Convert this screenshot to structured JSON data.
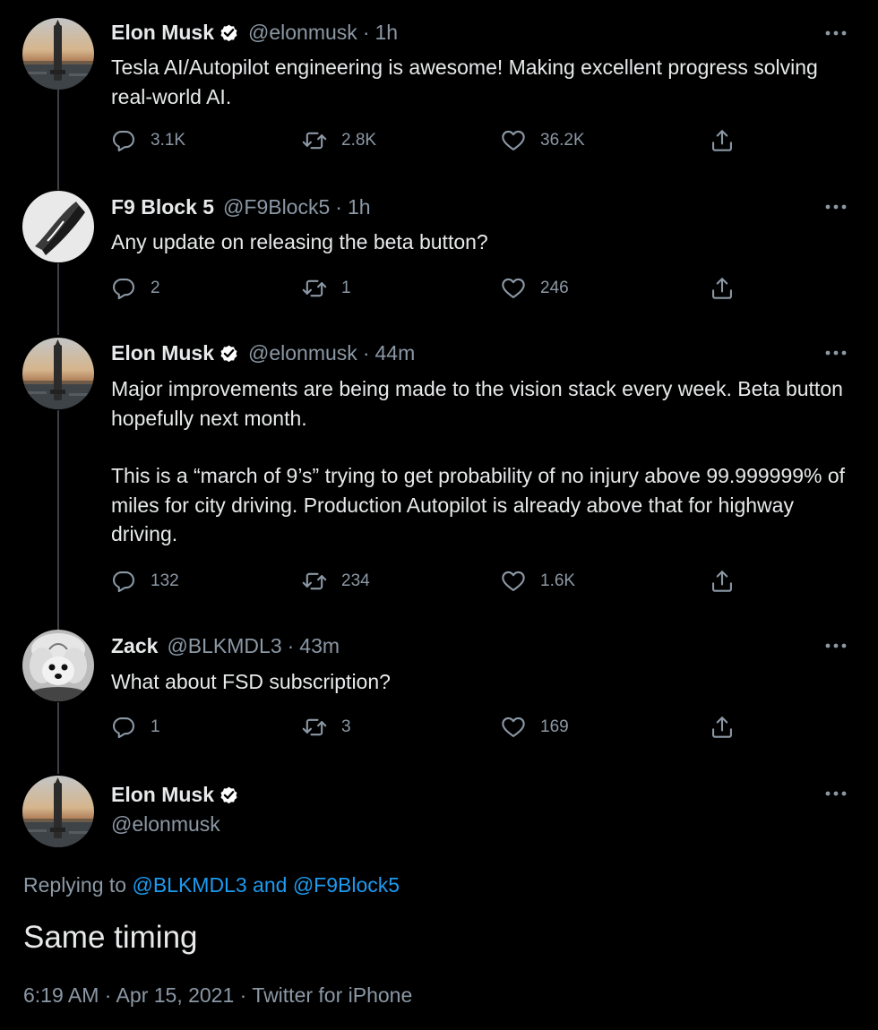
{
  "thread": [
    {
      "name": "Elon Musk",
      "verified": true,
      "handle": "@elonmusk",
      "separator": "·",
      "time": "1h",
      "paragraphs": [
        "Tesla AI/Autopilot engineering is awesome! Making excellent progress solving real-world AI."
      ],
      "replies": "3.1K",
      "retweets": "2.8K",
      "likes": "36.2K"
    },
    {
      "name": "F9 Block 5",
      "verified": false,
      "handle": "@F9Block5",
      "separator": "·",
      "time": "1h",
      "paragraphs": [
        "Any update on releasing the beta button?"
      ],
      "replies": "2",
      "retweets": "1",
      "likes": "246"
    },
    {
      "name": "Elon Musk",
      "verified": true,
      "handle": "@elonmusk",
      "separator": "·",
      "time": "44m",
      "paragraphs": [
        "Major improvements are being made to the vision stack every week. Beta button hopefully next month.",
        "This is a “march of 9’s” trying to get probability of no injury above 99.999999% of miles for city driving. Production Autopilot is already above that for highway driving."
      ],
      "replies": "132",
      "retweets": "234",
      "likes": "1.6K"
    },
    {
      "name": "Zack",
      "verified": false,
      "handle": "@BLKMDL3",
      "separator": "·",
      "time": "43m",
      "paragraphs": [
        "What about FSD subscription?"
      ],
      "replies": "1",
      "retweets": "3",
      "likes": "169"
    }
  ],
  "main_tweet": {
    "name": "Elon Musk",
    "handle": "@elonmusk",
    "replying_prefix": "Replying to ",
    "replying_user1": "@BLKMDL3",
    "replying_and": " and ",
    "replying_user2": "@F9Block5",
    "text": "Same timing",
    "meta": "6:19 AM · Apr 15, 2021 · Twitter for iPhone"
  },
  "colors": {
    "background": "#000000",
    "text_primary": "#e7e9ea",
    "text_secondary": "#8b98a5",
    "link": "#1d9bf0",
    "thread_line": "#3d4147"
  },
  "icons": {
    "reply": "reply-icon",
    "retweet": "retweet-icon",
    "like": "heart-icon",
    "share": "share-icon",
    "more": "more-icon",
    "verified": "verified-badge-icon"
  }
}
